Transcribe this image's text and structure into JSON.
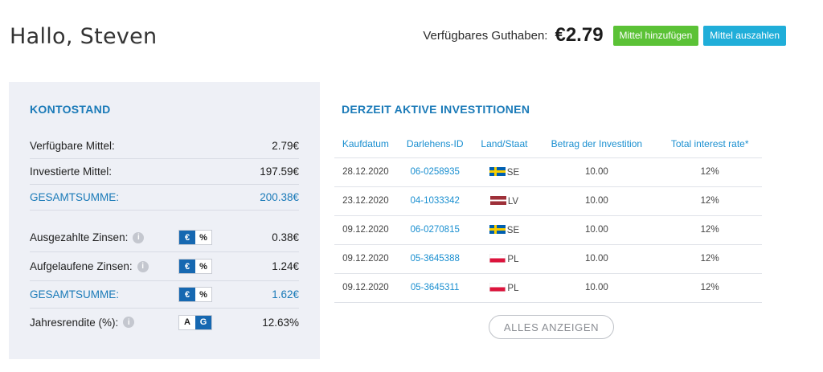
{
  "greeting": "Hallo, Steven",
  "balance": {
    "label": "Verfügbares Guthaben:",
    "amount": "€2.79",
    "add_funds": "Mittel hinzufügen",
    "withdraw_funds": "Mittel auszahlen"
  },
  "account": {
    "title": "KONTOSTAND",
    "available_label": "Verfügbare Mittel:",
    "available_value": "2.79€",
    "invested_label": "Investierte Mittel:",
    "invested_value": "197.59€",
    "total1_label": "GESAMTSUMME:",
    "total1_value": "200.38€",
    "paid_interest_label": "Ausgezahlte Zinsen:",
    "paid_interest_value": "0.38€",
    "accrued_interest_label": "Aufgelaufene Zinsen:",
    "accrued_interest_value": "1.24€",
    "total2_label": "GESAMTSUMME:",
    "total2_value": "1.62€",
    "annual_return_label": "Jahresrendite (%):",
    "annual_return_value": "12.63%",
    "toggle_euro": "€",
    "toggle_percent": "%",
    "toggle_a": "A",
    "toggle_g": "G",
    "info_glyph": "i"
  },
  "investments": {
    "title": "DERZEIT AKTIVE INVESTITIONEN",
    "columns": [
      "Kaufdatum",
      "Darlehens-ID",
      "Land/Staat",
      "Betrag der Investition",
      "Total interest rate*"
    ],
    "rows": [
      {
        "date": "28.12.2020",
        "loan_id": "06-0258935",
        "country": "SE",
        "amount": "10.00",
        "rate": "12%"
      },
      {
        "date": "23.12.2020",
        "loan_id": "04-1033342",
        "country": "LV",
        "amount": "10.00",
        "rate": "12%"
      },
      {
        "date": "09.12.2020",
        "loan_id": "06-0270815",
        "country": "SE",
        "amount": "10.00",
        "rate": "12%"
      },
      {
        "date": "09.12.2020",
        "loan_id": "05-3645388",
        "country": "PL",
        "amount": "10.00",
        "rate": "12%"
      },
      {
        "date": "09.12.2020",
        "loan_id": "05-3645311",
        "country": "PL",
        "amount": "10.00",
        "rate": "12%"
      }
    ],
    "show_all": "ALLES ANZEIGEN"
  },
  "colors": {
    "green_button": "#5bc236",
    "blue_button": "#20aed9",
    "accent": "#1a7ab8",
    "toggle_active": "#1668b1"
  }
}
